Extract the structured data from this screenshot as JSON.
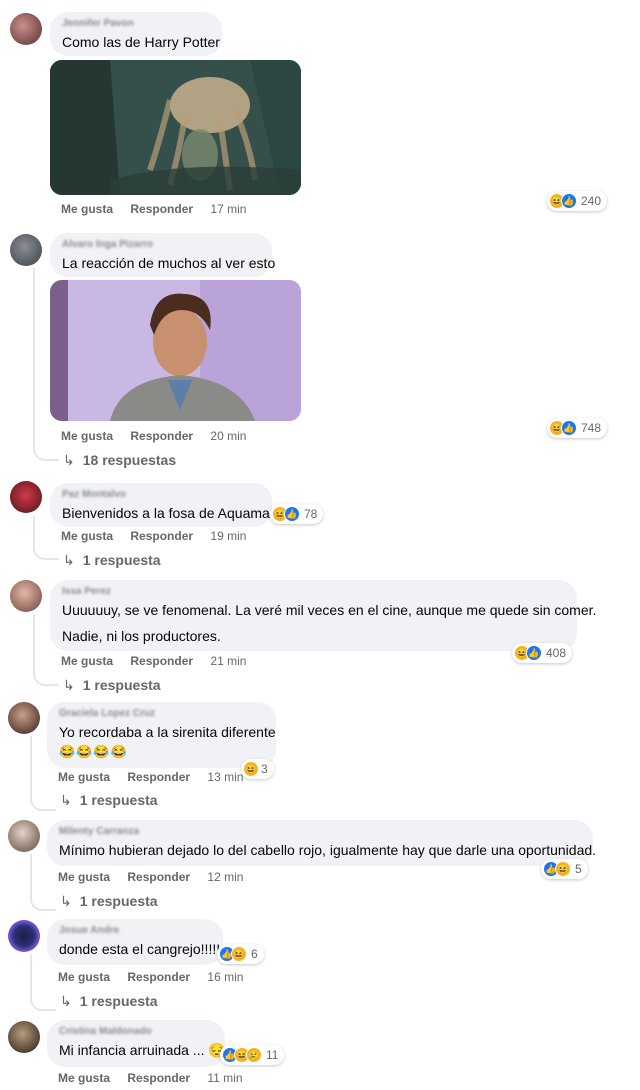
{
  "colors": {
    "bubble": "#f0f2f5",
    "meta": "#65676b",
    "like_blue": "#1877f2",
    "haha_yellow": "#f7b125"
  },
  "common": {
    "like_label": "Me gusta",
    "reply_label": "Responder"
  },
  "comments": [
    {
      "author": "Jennifer Pavon",
      "texts": [
        "Como las de Harry Potter"
      ],
      "media": "underwater-hair-gif",
      "time": "17 min",
      "reactions": [
        "haha",
        "like"
      ],
      "reaction_count": "240",
      "replies": ""
    },
    {
      "author": "Alvaro Inga Pizarro",
      "texts": [
        "La reacción de muchos al ver esto"
      ],
      "media": "surprised-man-gif",
      "time": "20 min",
      "reactions": [
        "haha",
        "like"
      ],
      "reaction_count": "748",
      "replies": "18 respuestas"
    },
    {
      "author": "Paz Montalvo",
      "texts": [
        "Bienvenidos a la fosa de Aquaman"
      ],
      "time": "19 min",
      "reactions": [
        "haha",
        "like"
      ],
      "reaction_count": "78",
      "replies": "1 respuesta"
    },
    {
      "author": "Issa Perez",
      "texts": [
        "Uuuuuuy, se ve fenomenal. La veré mil veces en el cine, aunque me quede sin comer.",
        "Nadie, ni los productores."
      ],
      "time": "21 min",
      "reactions": [
        "haha",
        "like"
      ],
      "reaction_count": "408",
      "replies": "1 respuesta"
    },
    {
      "author": "Graciela Lopez Cruz",
      "texts": [
        "Yo recordaba a la sirenita diferente",
        "😂😂😂😂"
      ],
      "time": "13 min",
      "reactions": [
        "haha"
      ],
      "reaction_count": "3",
      "replies": "1 respuesta"
    },
    {
      "author": "Milenty Carranza",
      "texts": [
        "Mínimo hubieran dejado lo del cabello rojo, igualmente hay que darle una oportunidad."
      ],
      "time": "12 min",
      "reactions": [
        "like",
        "haha"
      ],
      "reaction_count": "5",
      "replies": "1 respuesta"
    },
    {
      "author": "Josue Andre",
      "texts": [
        "donde esta el cangrejo!!!!!"
      ],
      "time": "16 min",
      "reactions": [
        "like",
        "haha"
      ],
      "reaction_count": "6",
      "replies": "1 respuesta"
    },
    {
      "author": "Cristina Maldonado",
      "texts": [
        "Mi infancia arruinada ... 😔"
      ],
      "time": "11 min",
      "reactions": [
        "like",
        "haha",
        "sad"
      ],
      "reaction_count": "11",
      "replies": ""
    }
  ]
}
